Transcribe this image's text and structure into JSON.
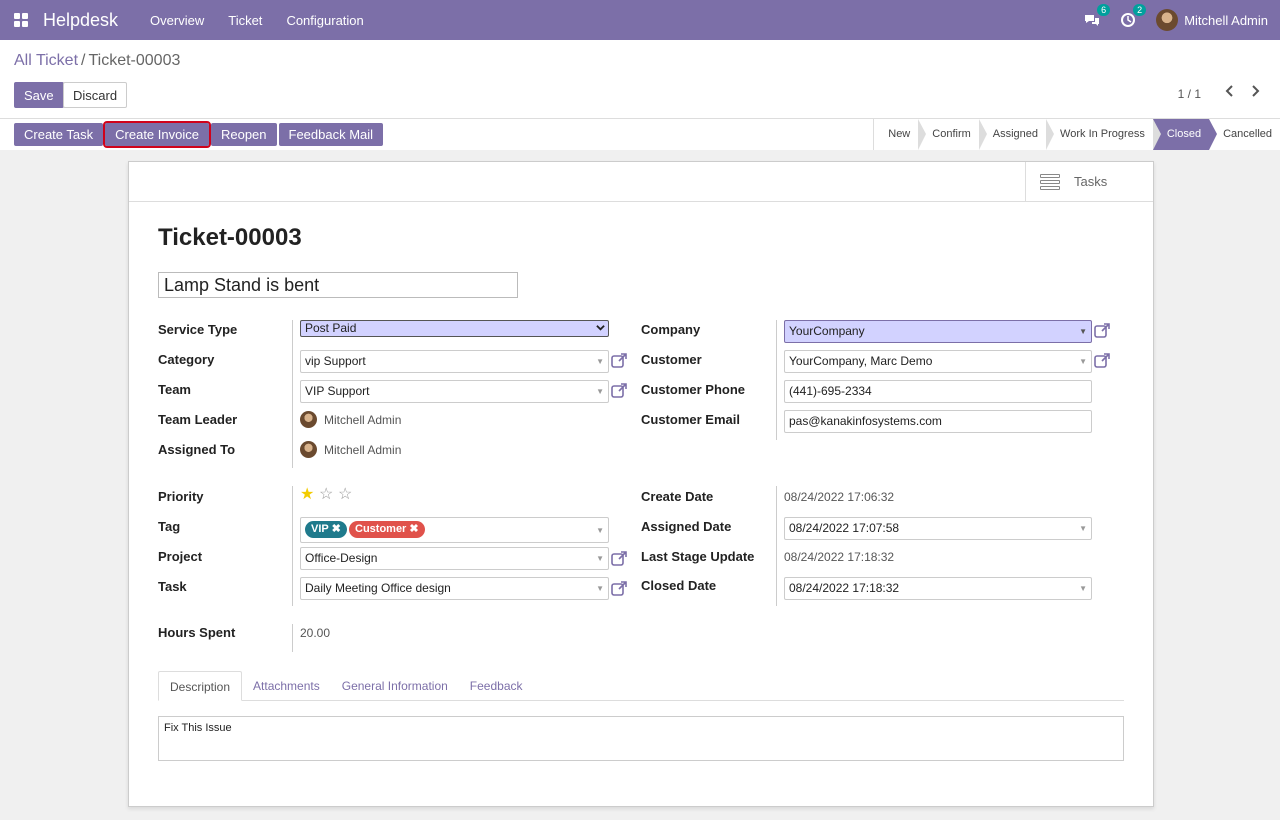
{
  "navbar": {
    "brand": "Helpdesk",
    "menu": [
      "Overview",
      "Ticket",
      "Configuration"
    ],
    "messages_count": "6",
    "activities_count": "2",
    "user": "Mitchell Admin"
  },
  "breadcrumb": {
    "parent": "All Ticket",
    "separator": "/",
    "current": "Ticket-00003"
  },
  "buttons": {
    "save": "Save",
    "discard": "Discard"
  },
  "pager": {
    "value": "1 / 1"
  },
  "actions": {
    "create_task": "Create Task",
    "create_invoice": "Create Invoice",
    "reopen": "Reopen",
    "feedback_mail": "Feedback Mail"
  },
  "stages": [
    "New",
    "Confirm",
    "Assigned",
    "Work In Progress",
    "Closed",
    "Cancelled"
  ],
  "active_stage": "Closed",
  "smart_button": {
    "label": "Tasks"
  },
  "ticket": {
    "title": "Ticket-00003",
    "subject": "Lamp Stand is bent",
    "labels": {
      "service_type": "Service Type",
      "category": "Category",
      "team": "Team",
      "team_leader": "Team Leader",
      "assigned_to": "Assigned To",
      "company": "Company",
      "customer": "Customer",
      "customer_phone": "Customer Phone",
      "customer_email": "Customer Email",
      "priority": "Priority",
      "tag": "Tag",
      "project": "Project",
      "task": "Task",
      "create_date": "Create Date",
      "assigned_date": "Assigned Date",
      "last_stage_update": "Last Stage Update",
      "closed_date": "Closed Date",
      "hours_spent": "Hours Spent"
    },
    "service_type": "Post Paid",
    "category": "vip Support",
    "team": "VIP Support",
    "team_leader": "Mitchell Admin",
    "assigned_to": "Mitchell Admin",
    "company": "YourCompany",
    "customer": "YourCompany, Marc Demo",
    "customer_phone": "(441)-695-2334",
    "customer_email": "pas@kanakinfosystems.com",
    "priority_stars": 1,
    "tags": [
      {
        "label": "VIP",
        "color": "#1f7a8c"
      },
      {
        "label": "Customer",
        "color": "#e0524b"
      }
    ],
    "tag_remove_glyph": "✖",
    "project": "Office-Design",
    "task": "Daily Meeting Office design",
    "create_date": "08/24/2022 17:06:32",
    "assigned_date": "08/24/2022 17:07:58",
    "last_stage_update": "08/24/2022 17:18:32",
    "closed_date": "08/24/2022 17:18:32",
    "hours_spent": "20.00"
  },
  "tabs": [
    "Description",
    "Attachments",
    "General Information",
    "Feedback"
  ],
  "description": "Fix This Issue",
  "colors": {
    "primary": "#7c6fa8",
    "highlight": "#d0021b",
    "star": "#f3cc00"
  }
}
